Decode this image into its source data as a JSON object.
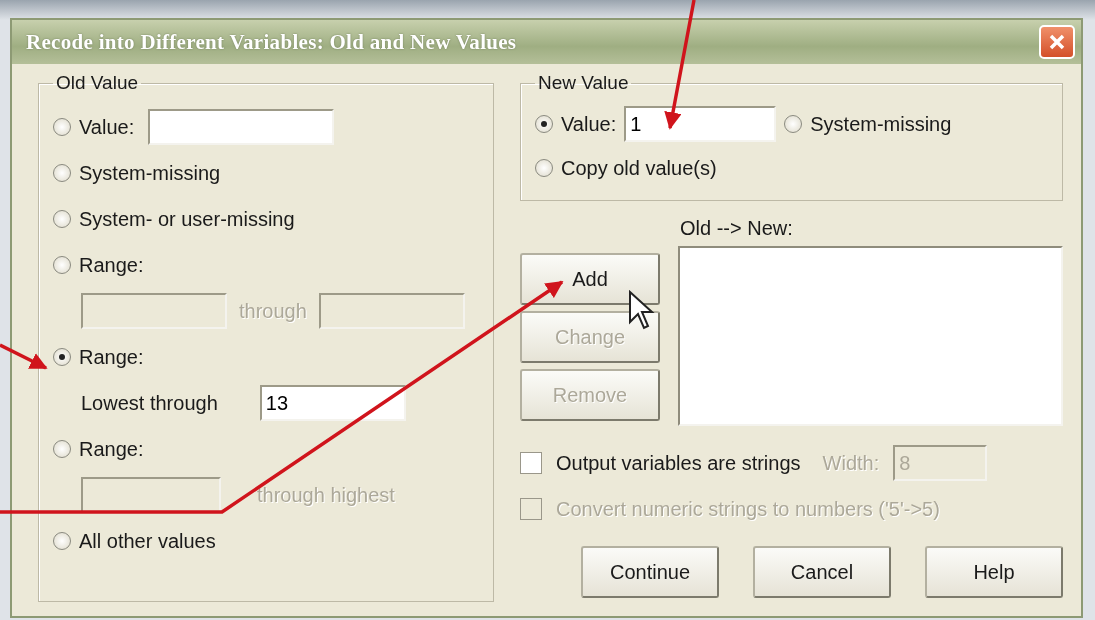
{
  "window": {
    "title": "Recode into Different Variables: Old and New Values"
  },
  "old_value": {
    "title": "Old Value",
    "options": [
      {
        "kind": "value",
        "label": "Value:",
        "selected": false
      },
      {
        "kind": "plain",
        "label": "System-missing",
        "selected": false
      },
      {
        "kind": "plain",
        "label": "System- or user-missing",
        "selected": false
      },
      {
        "kind": "range",
        "label": "Range:",
        "selected": false,
        "between": "through"
      },
      {
        "kind": "range_low",
        "label": "Range:",
        "selected": true,
        "caption": "Lowest through",
        "value": "13"
      },
      {
        "kind": "range_high",
        "label": "Range:",
        "selected": false,
        "caption": "through highest"
      },
      {
        "kind": "plain",
        "label": "All other values",
        "selected": false
      }
    ]
  },
  "new_value": {
    "title": "New Value",
    "options": [
      {
        "kind": "value",
        "label": "Value:",
        "selected": true,
        "value": "1"
      },
      {
        "kind": "plain",
        "label": "System-missing",
        "selected": false
      },
      {
        "kind": "plain",
        "label": "Copy old value(s)",
        "selected": false
      }
    ]
  },
  "mapping": {
    "label": "Old --> New:"
  },
  "side_buttons": [
    {
      "label": "Add",
      "disabled": false
    },
    {
      "label": "Change",
      "disabled": true
    },
    {
      "label": "Remove",
      "disabled": true
    }
  ],
  "output_strings": {
    "label": "Output variables are strings",
    "checked": false,
    "disabled": false,
    "width_label": "Width:",
    "width_value": "8",
    "width_disabled": true
  },
  "convert_numeric": {
    "label": "Convert numeric strings to numbers ('5'->5)",
    "checked": false,
    "disabled": true
  },
  "buttons": [
    {
      "label": "Continue"
    },
    {
      "label": "Cancel"
    },
    {
      "label": "Help"
    }
  ]
}
